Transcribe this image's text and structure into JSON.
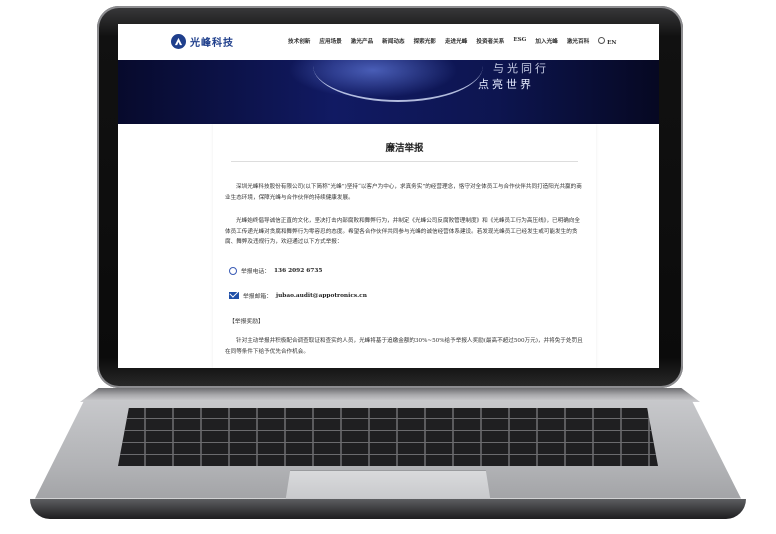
{
  "site": {
    "logo_text": "光峰科技",
    "nav": [
      "技术创新",
      "应用场景",
      "激光产品",
      "新闻动态",
      "探索光影",
      "走进光峰",
      "投资者关系",
      "ESG",
      "加入光峰",
      "激光百科"
    ],
    "lang": "EN"
  },
  "hero": {
    "line1": "与光同行",
    "line2": "点亮世界"
  },
  "article": {
    "title": "廉洁举报",
    "para1": "深圳光峰科技股份有限公司(以下简称“光峰”)坚持“以客户为中心，求真务实”的经营理念，恪守对全体员工与合作伙伴共同打造阳光共赢的商业生态环境，保障光峰与合作伙伴的持续健康发展。",
    "para2": "光峰始终倡导诚信正直的文化，坚决打击内部腐败和舞弊行为，并制定《光峰公司反腐败管理制度》和《光峰员工行为高压线》，已明确向全体员工传递光峰对贪腐和舞弊行为零容忍的态度。希望各合作伙伴共同参与光峰的诚信经营体系建设。若发现光峰员工已经发生或可能发生的贪腐、舞弊及违规行为，欢迎通过以下方式举报：",
    "phone_label": "举报电话：",
    "phone": "136 2092 6735",
    "email_label": "举报邮箱：",
    "email": "jubao.audit@appotronics.cn",
    "reward_heading": "【举报奖励】",
    "para3": "针对主动举报并积极配合调查取证和查实的人员，光峰将基于追缴金额的30%~50%给予举报人奖励(最高不超过500万元)，并将免于处罚且在同等条件下给予优先合作机会。"
  },
  "colors": {
    "brand": "#1f3f8c",
    "hero_dark": "#0b1150"
  }
}
